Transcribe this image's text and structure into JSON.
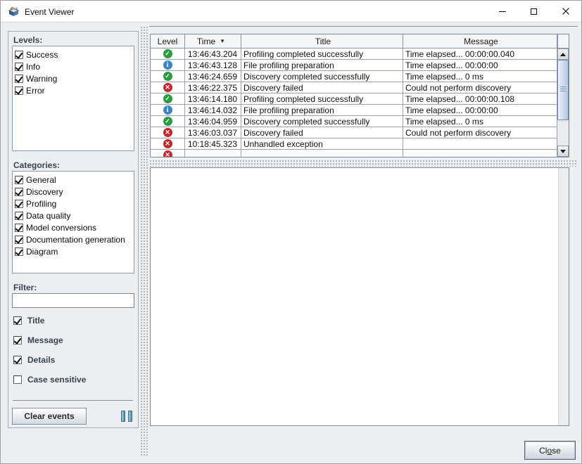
{
  "window": {
    "title": "Event Viewer"
  },
  "left_panel": {
    "levels": {
      "label": "Levels:",
      "items": [
        {
          "label": "Success",
          "checked": true
        },
        {
          "label": "Info",
          "checked": true
        },
        {
          "label": "Warning",
          "checked": true
        },
        {
          "label": "Error",
          "checked": true
        }
      ]
    },
    "categories": {
      "label": "Categories:",
      "items": [
        {
          "label": "General",
          "checked": true
        },
        {
          "label": "Discovery",
          "checked": true
        },
        {
          "label": "Profiling",
          "checked": true
        },
        {
          "label": "Data quality",
          "checked": true
        },
        {
          "label": "Model conversions",
          "checked": true
        },
        {
          "label": "Documentation generation",
          "checked": true
        },
        {
          "label": "Diagram",
          "checked": true
        }
      ]
    },
    "filter": {
      "label": "Filter:",
      "value": "",
      "options": [
        {
          "label": "Title",
          "checked": true
        },
        {
          "label": "Message",
          "checked": true
        },
        {
          "label": "Details",
          "checked": true
        },
        {
          "label": "Case sensitive",
          "checked": false
        }
      ]
    },
    "clear_button_label": "Clear events"
  },
  "table": {
    "columns": [
      {
        "label": "Level"
      },
      {
        "label": "Time"
      },
      {
        "label": "Title"
      },
      {
        "label": "Message"
      }
    ],
    "sort": {
      "column": "Time",
      "direction": "desc",
      "glyph": "▼"
    },
    "level_icons": {
      "success": "✓",
      "info": "i",
      "error": "✕"
    },
    "rows": [
      {
        "level": "success",
        "time": "13:46:43.204",
        "title": "Profiling completed successfully",
        "message": "Time elapsed... 00:00:00.040"
      },
      {
        "level": "info",
        "time": "13:46:43.128",
        "title": "File profiling preparation",
        "message": "Time elapsed... 00:00:00"
      },
      {
        "level": "success",
        "time": "13:46:24.659",
        "title": "Discovery completed successfully",
        "message": "Time elapsed... 0 ms"
      },
      {
        "level": "error",
        "time": "13:46:22.375",
        "title": "Discovery failed",
        "message": "Could not perform discovery"
      },
      {
        "level": "success",
        "time": "13:46:14.180",
        "title": "Profiling completed successfully",
        "message": "Time elapsed... 00:00:00.108"
      },
      {
        "level": "info",
        "time": "13:46:14.032",
        "title": "File profiling preparation",
        "message": "Time elapsed... 00:00:00"
      },
      {
        "level": "success",
        "time": "13:46:04.959",
        "title": "Discovery completed successfully",
        "message": "Time elapsed... 0 ms"
      },
      {
        "level": "error",
        "time": "13:46:03.037",
        "title": "Discovery failed",
        "message": "Could not perform discovery"
      },
      {
        "level": "error",
        "time": "10:18:45.323",
        "title": "Unhandled exception",
        "message": ""
      },
      {
        "level": "error",
        "time": "",
        "title": "",
        "message": "",
        "partial": true
      }
    ]
  },
  "details_panel": {
    "content": ""
  },
  "footer": {
    "close_label": "Close",
    "close_mnemonic_index": 2
  },
  "colors": {
    "success": "#2a9b43",
    "info": "#3b85c6",
    "error": "#c4262e",
    "label_accent": "#3a4452",
    "grid_line": "#97a3b3",
    "pause_icon": "#548bab"
  }
}
